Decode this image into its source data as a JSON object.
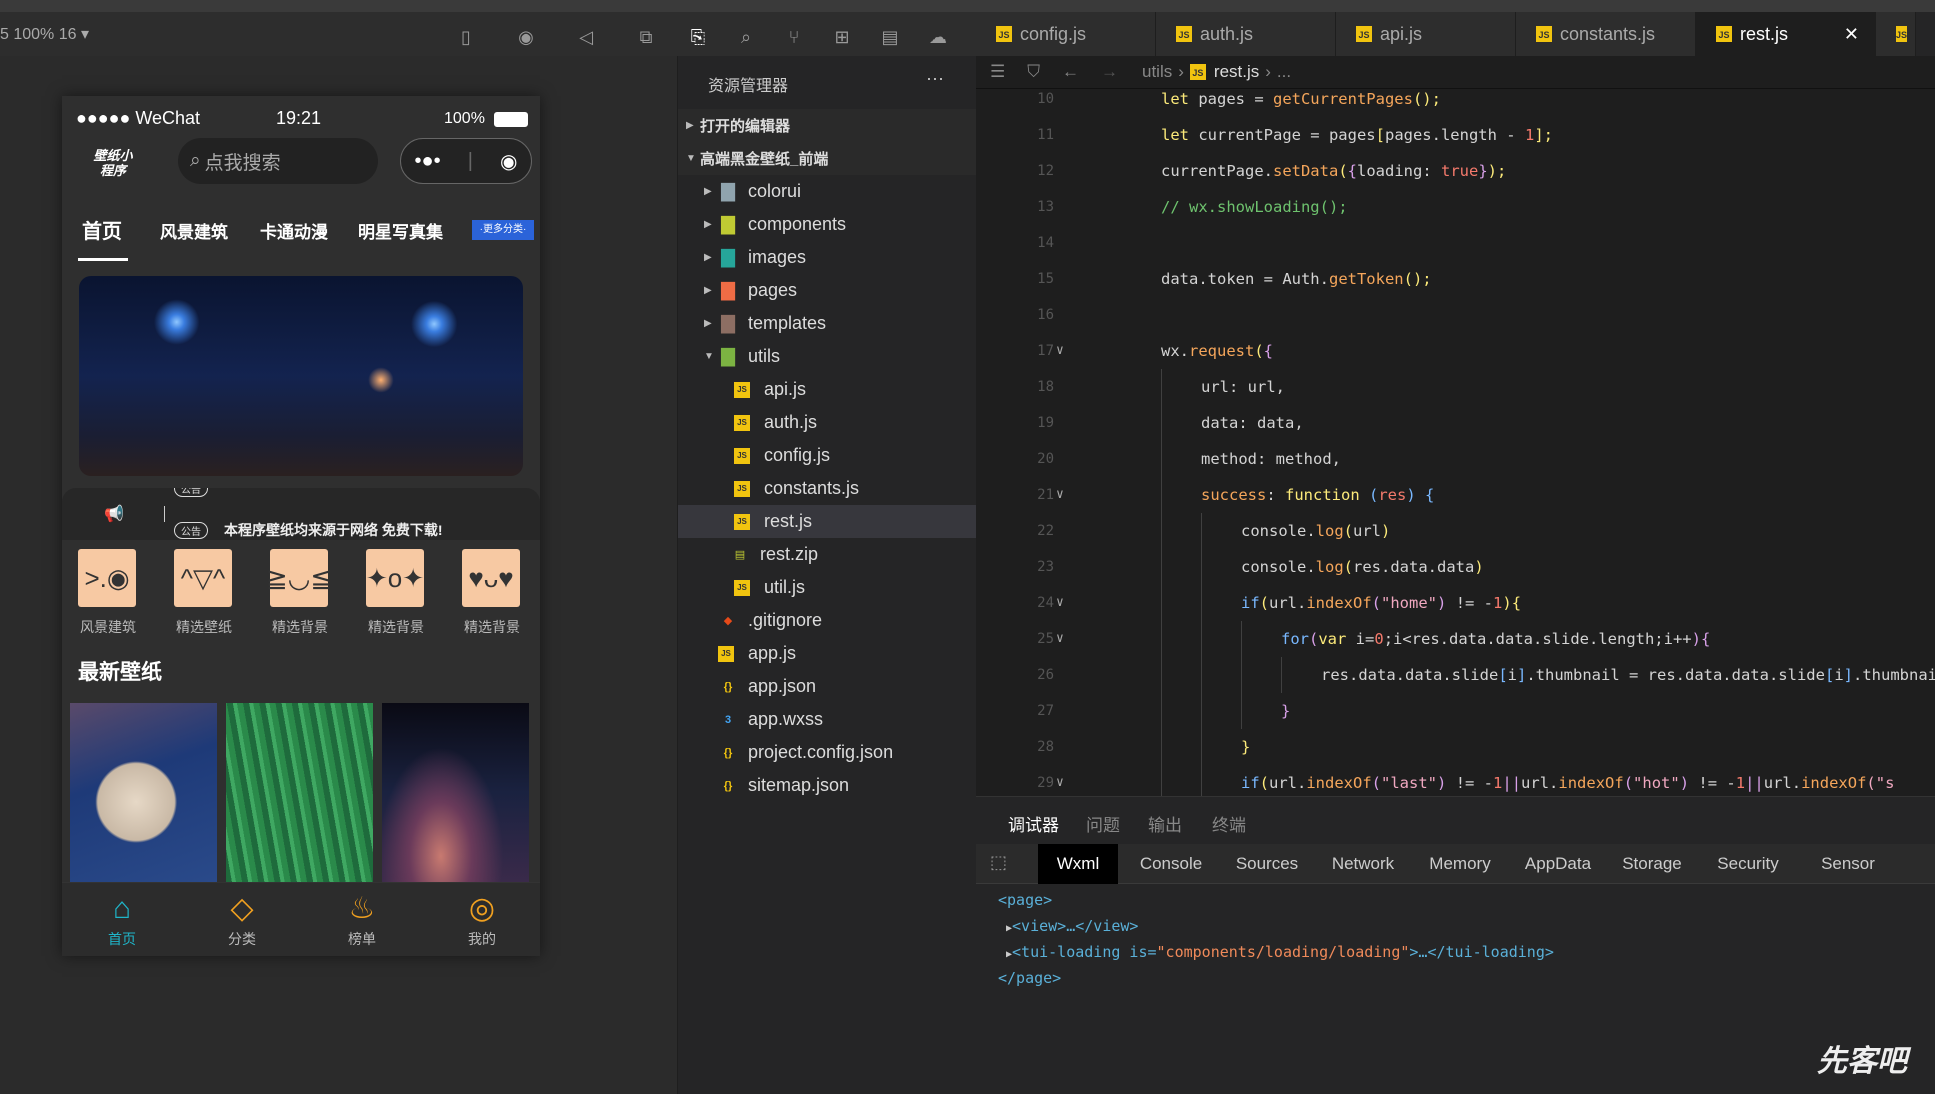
{
  "simulator": {
    "zoom_label": "5 100% 16 ▾",
    "status": {
      "carrier": "●●●●● WeChat",
      "time": "19:21",
      "battery": "100%"
    },
    "logo": "壁纸小程序",
    "search_placeholder": "点我搜索",
    "nav_tabs": [
      "首页",
      "风景建筑",
      "卡通动漫",
      "明星写真集"
    ],
    "more_label": "·更多分类·",
    "notice": {
      "badge": "公告",
      "text": "本程序壁纸均来源于网络 免费下载!"
    },
    "categories": [
      {
        "label": "风景建筑",
        "face": ">.◉"
      },
      {
        "label": "精选壁纸",
        "face": "^▽^"
      },
      {
        "label": "精选背景",
        "face": "≧◡≦"
      },
      {
        "label": "精选背景",
        "face": "✦o✦"
      },
      {
        "label": "精选背景",
        "face": "♥ᴗ♥"
      }
    ],
    "section_title": "最新壁纸",
    "tabbar": [
      {
        "label": "首页",
        "icon": "home-icon",
        "active": true
      },
      {
        "label": "分类",
        "icon": "category-icon"
      },
      {
        "label": "榜单",
        "icon": "fire-icon"
      },
      {
        "label": "我的",
        "icon": "user-icon"
      }
    ],
    "accent": "#1fb5c9"
  },
  "explorer": {
    "title": "资源管理器",
    "more": "···",
    "open_editors": "打开的编辑器",
    "project": "高端黑金壁纸_前端",
    "items": [
      {
        "name": "colorui",
        "type": "folder",
        "depth": 1,
        "color": "#90a4ae"
      },
      {
        "name": "components",
        "type": "folder",
        "depth": 1,
        "color": "#c0ca33"
      },
      {
        "name": "images",
        "type": "folder",
        "depth": 1,
        "color": "#26a69a"
      },
      {
        "name": "pages",
        "type": "folder",
        "depth": 1,
        "color": "#ef6c45"
      },
      {
        "name": "templates",
        "type": "folder",
        "depth": 1,
        "color": "#8d6e63"
      },
      {
        "name": "utils",
        "type": "folder-open",
        "depth": 1,
        "color": "#7cb342"
      },
      {
        "name": "api.js",
        "type": "js",
        "depth": 2
      },
      {
        "name": "auth.js",
        "type": "js",
        "depth": 2
      },
      {
        "name": "config.js",
        "type": "js",
        "depth": 2
      },
      {
        "name": "constants.js",
        "type": "js",
        "depth": 2
      },
      {
        "name": "rest.js",
        "type": "js",
        "depth": 2,
        "selected": true
      },
      {
        "name": "rest.zip",
        "type": "zip",
        "depth": 2
      },
      {
        "name": "util.js",
        "type": "js",
        "depth": 2
      },
      {
        "name": ".gitignore",
        "type": "git",
        "depth": 1
      },
      {
        "name": "app.js",
        "type": "js",
        "depth": 1
      },
      {
        "name": "app.json",
        "type": "json",
        "depth": 1
      },
      {
        "name": "app.wxss",
        "type": "css",
        "depth": 1
      },
      {
        "name": "project.config.json",
        "type": "json",
        "depth": 1
      },
      {
        "name": "sitemap.json",
        "type": "json",
        "depth": 1
      }
    ]
  },
  "editor": {
    "tabs": [
      "config.js",
      "auth.js",
      "api.js",
      "constants.js",
      "rest.js"
    ],
    "active_tab": "rest.js",
    "breadcrumb": [
      "utils",
      "rest.js",
      "..."
    ],
    "lines": [
      {
        "n": "10",
        "i": 0,
        "t": [
          [
            "let ",
            "kw"
          ],
          [
            "pages = ",
            "id"
          ],
          [
            "getCurrentPages",
            "fn"
          ],
          [
            "();",
            "kw"
          ]
        ]
      },
      {
        "n": "11",
        "i": 0,
        "t": [
          [
            "let ",
            "kw"
          ],
          [
            "currentPage = pages",
            "id"
          ],
          [
            "[",
            "kw"
          ],
          [
            "pages.length - ",
            "id"
          ],
          [
            "1",
            "num"
          ],
          [
            "];",
            "kw"
          ]
        ]
      },
      {
        "n": "12",
        "i": 0,
        "t": [
          [
            "currentPage.",
            "id"
          ],
          [
            "setData",
            "fn"
          ],
          [
            "(",
            "kw"
          ],
          [
            "{",
            "br"
          ],
          [
            "loading: ",
            "id"
          ],
          [
            "true",
            "num"
          ],
          [
            "}",
            "br"
          ],
          [
            ");",
            "kw"
          ]
        ]
      },
      {
        "n": "13",
        "i": 0,
        "t": [
          [
            "// wx.showLoading();",
            "cm"
          ]
        ]
      },
      {
        "n": "14",
        "i": 0,
        "t": []
      },
      {
        "n": "15",
        "i": 0,
        "t": [
          [
            "data.token = Auth.",
            "id"
          ],
          [
            "getToken",
            "fn"
          ],
          [
            "();",
            "kw"
          ]
        ]
      },
      {
        "n": "16",
        "i": 0,
        "t": []
      },
      {
        "n": "17",
        "i": 0,
        "f": true,
        "t": [
          [
            "wx.",
            "id"
          ],
          [
            "request",
            "fn"
          ],
          [
            "(",
            "kw"
          ],
          [
            "{",
            "br"
          ]
        ]
      },
      {
        "n": "18",
        "i": 1,
        "t": [
          [
            "url: url,",
            "id"
          ]
        ]
      },
      {
        "n": "19",
        "i": 1,
        "t": [
          [
            "data: data,",
            "id"
          ]
        ]
      },
      {
        "n": "20",
        "i": 1,
        "t": [
          [
            "method: method,",
            "id"
          ]
        ]
      },
      {
        "n": "21",
        "i": 1,
        "f": true,
        "t": [
          [
            "success",
            "fn"
          ],
          [
            ": ",
            "id"
          ],
          [
            "function ",
            "kw"
          ],
          [
            "(",
            "bl"
          ],
          [
            "res",
            "num"
          ],
          [
            ") {",
            "bl"
          ]
        ]
      },
      {
        "n": "22",
        "i": 2,
        "t": [
          [
            "console.",
            "id"
          ],
          [
            "log",
            "fn"
          ],
          [
            "(",
            "kw"
          ],
          [
            "url",
            "id"
          ],
          [
            ")",
            "kw"
          ]
        ]
      },
      {
        "n": "23",
        "i": 2,
        "t": [
          [
            "console.",
            "id"
          ],
          [
            "log",
            "fn"
          ],
          [
            "(",
            "kw"
          ],
          [
            "res.data.data",
            "id"
          ],
          [
            ")",
            "kw"
          ]
        ]
      },
      {
        "n": "24",
        "i": 2,
        "f": true,
        "t": [
          [
            "if",
            "bl"
          ],
          [
            "(",
            "kw"
          ],
          [
            "url.",
            "id"
          ],
          [
            "indexOf",
            "fn"
          ],
          [
            "(",
            "br"
          ],
          [
            "\"home\"",
            "str"
          ],
          [
            ")",
            "br"
          ],
          [
            " != -",
            "id"
          ],
          [
            "1",
            "num"
          ],
          [
            "){",
            "kw"
          ]
        ]
      },
      {
        "n": "25",
        "i": 3,
        "f": true,
        "t": [
          [
            "for",
            "bl"
          ],
          [
            "(",
            "br"
          ],
          [
            "var ",
            "kw"
          ],
          [
            "i=",
            "id"
          ],
          [
            "0",
            "num"
          ],
          [
            ";i<res.data.data.slide.length;i++",
            "id"
          ],
          [
            "){",
            "br"
          ]
        ]
      },
      {
        "n": "26",
        "i": 4,
        "t": [
          [
            "res.data.data.slide",
            "id"
          ],
          [
            "[",
            "bl"
          ],
          [
            "i",
            "id"
          ],
          [
            "]",
            "bl"
          ],
          [
            ".thumbnail = res.data.data.slide",
            "id"
          ],
          [
            "[",
            "bl"
          ],
          [
            "i",
            "id"
          ],
          [
            "]",
            "bl"
          ],
          [
            ".thumbnail",
            "id"
          ]
        ]
      },
      {
        "n": "27",
        "i": 3,
        "t": [
          [
            "}",
            "br"
          ]
        ]
      },
      {
        "n": "28",
        "i": 2,
        "t": [
          [
            "}",
            "kw"
          ]
        ]
      },
      {
        "n": "29",
        "i": 2,
        "f": true,
        "t": [
          [
            "if",
            "bl"
          ],
          [
            "(",
            "kw"
          ],
          [
            "url.",
            "id"
          ],
          [
            "indexOf",
            "fn"
          ],
          [
            "(",
            "br"
          ],
          [
            "\"last\"",
            "str"
          ],
          [
            ")",
            "br"
          ],
          [
            " != -",
            "id"
          ],
          [
            "1",
            "num"
          ],
          [
            "||",
            "br"
          ],
          [
            "url.",
            "id"
          ],
          [
            "indexOf",
            "fn"
          ],
          [
            "(",
            "br"
          ],
          [
            "\"hot\"",
            "str"
          ],
          [
            ")",
            "br"
          ],
          [
            " != -",
            "id"
          ],
          [
            "1",
            "num"
          ],
          [
            "||",
            "br"
          ],
          [
            "url.",
            "id"
          ],
          [
            "indexOf",
            "fn"
          ],
          [
            "(\"s",
            "str"
          ]
        ]
      }
    ]
  },
  "debugger": {
    "panel_tabs": [
      "调试器",
      "问题",
      "输出",
      "终端"
    ],
    "dev_tabs": [
      "Wxml",
      "Console",
      "Sources",
      "Network",
      "Memory",
      "AppData",
      "Storage",
      "Security",
      "Sensor"
    ],
    "active_dev_tab": "Wxml",
    "wxml": [
      "<page>",
      "<view>…</view>",
      "<tui-loading is=",
      "\"components/loading/loading\"",
      ">…</tui-loading>",
      "</page>"
    ]
  },
  "watermark": "先客吧"
}
